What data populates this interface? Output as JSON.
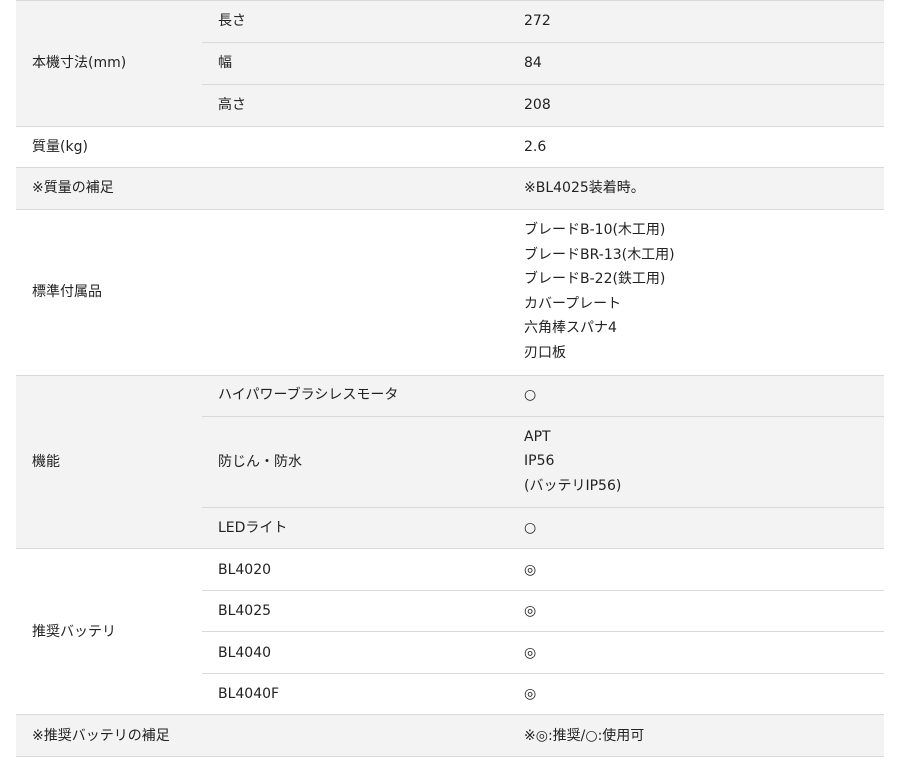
{
  "rows": {
    "dimensions": {
      "label": "本機寸法(mm)",
      "length_label": "長さ",
      "length_value": "272",
      "width_label": "幅",
      "width_value": "84",
      "height_label": "高さ",
      "height_value": "208"
    },
    "mass": {
      "label": "質量(kg)",
      "value": "2.6"
    },
    "mass_note": {
      "label": "※質量の補足",
      "value": "※BL4025装着時。"
    },
    "accessories": {
      "label": "標準付属品",
      "items": [
        "ブレードB-10(木工用)",
        "ブレードBR-13(木工用)",
        "ブレードB-22(鉄工用)",
        "カバープレート",
        "六角棒スパナ4",
        "刃口板"
      ]
    },
    "features": {
      "label": "機能",
      "motor_label": "ハイパワーブラシレスモータ",
      "motor_value": "○",
      "protection_label": "防じん・防水",
      "protection_values": [
        "APT",
        "IP56",
        "(バッテリIP56)"
      ],
      "led_label": "LEDライト",
      "led_value": "○"
    },
    "batteries": {
      "label": "推奨バッテリ",
      "items": [
        {
          "name": "BL4020",
          "mark": "◎"
        },
        {
          "name": "BL4025",
          "mark": "◎"
        },
        {
          "name": "BL4040",
          "mark": "◎"
        },
        {
          "name": "BL4040F",
          "mark": "◎"
        }
      ]
    },
    "battery_note": {
      "label": "※推奨バッテリの補足",
      "value": "※◎:推奨/○:使用可"
    }
  },
  "colors": {
    "shade": "#f3f3f3",
    "border": "#d9d9d9",
    "text": "#222222"
  }
}
